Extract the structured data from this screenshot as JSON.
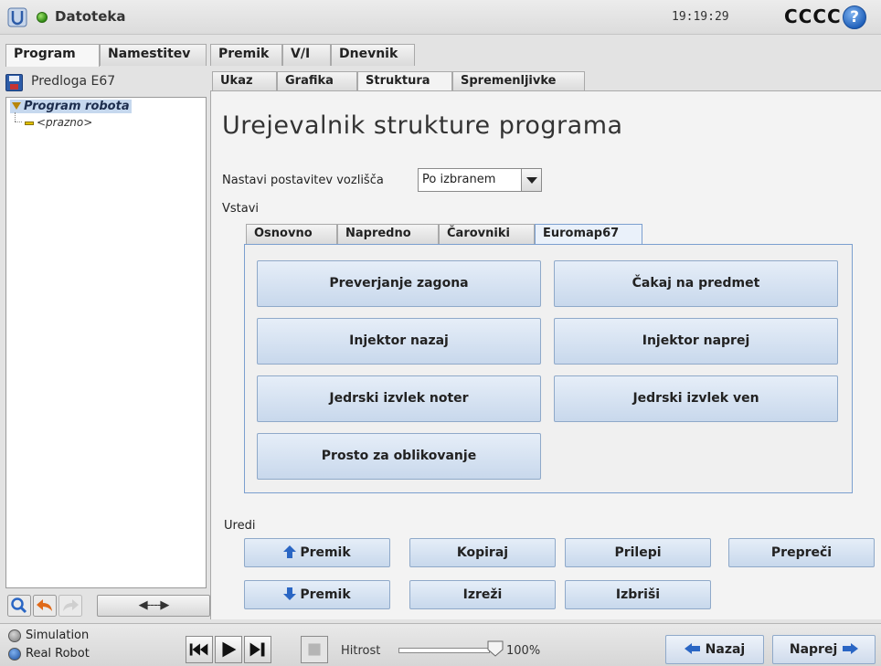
{
  "header": {
    "file_label": "Datoteka",
    "clock": "19:19:29",
    "robot_name": "CCCC",
    "help_symbol": "?",
    "logo_icon": "ur-logo-icon",
    "status_color": "#3a9a1c"
  },
  "main_tabs": [
    "Program",
    "Namestitev",
    "Premik",
    "V/I",
    "Dnevnik"
  ],
  "main_tab_active": "Program",
  "left_panel": {
    "title": "Predloga E67",
    "tree_root": "Program robota",
    "tree_child": "<prazno>"
  },
  "left_tools": {
    "arrows_label": "◀----▶"
  },
  "sub_tabs": [
    "Ukaz",
    "Grafika",
    "Struktura",
    "Spremenljivke"
  ],
  "sub_tab_active": "Struktura",
  "structure": {
    "title": "Urejevalnik strukture programa",
    "layout_label": "Nastavi postavitev vozlišča",
    "layout_value": "Po izbranem",
    "insert_label": "Vstavi",
    "insert_tabs": [
      "Osnovno",
      "Napredno",
      "Čarovniki",
      "Euromap67"
    ],
    "insert_tab_active": "Euromap67",
    "buttons": [
      "Preverjanje zagona",
      "Čakaj na predmet",
      "Injektor nazaj",
      "Injektor naprej",
      "Jedrski izvlek noter",
      "Jedrski izvlek ven",
      "Prosto za oblikovanje"
    ],
    "edit_label": "Uredi",
    "edit_buttons": {
      "move_up": "Premik",
      "copy": "Kopiraj",
      "paste": "Prilepi",
      "suppress": "Prepreči",
      "move_down": "Premik",
      "cut": "Izreži",
      "delete": "Izbriši"
    }
  },
  "bottom": {
    "simulation_label": "Simulation",
    "real_robot_label": "Real Robot",
    "speed_label": "Hitrost",
    "speed_value": "100%",
    "speed_fraction": 1.0,
    "back_label": "Nazaj",
    "next_label": "Naprej"
  }
}
